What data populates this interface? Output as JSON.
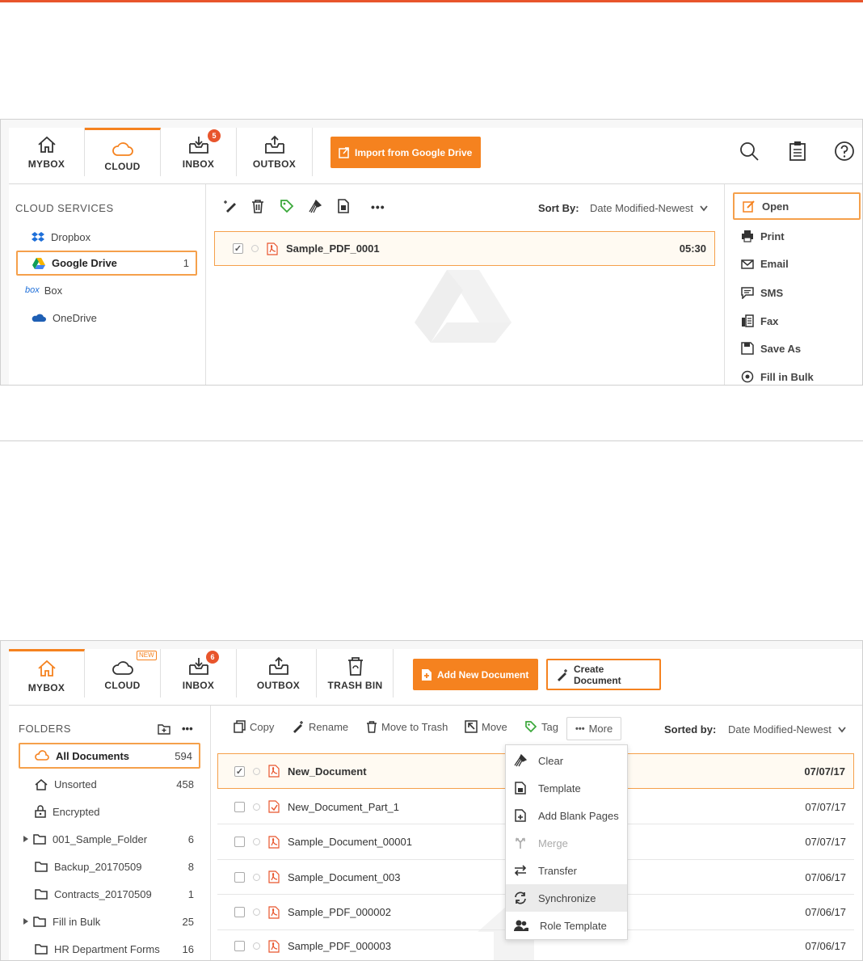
{
  "screen1": {
    "tabs": [
      {
        "label": "MYBOX"
      },
      {
        "label": "CLOUD"
      },
      {
        "label": "INBOX",
        "badge": "5"
      },
      {
        "label": "OUTBOX"
      }
    ],
    "import_button": "Import from Google Drive",
    "sidebar": {
      "heading": "CLOUD SERVICES",
      "items": [
        {
          "label": "Dropbox"
        },
        {
          "label": "Google Drive",
          "count": "1"
        },
        {
          "label": "Box"
        },
        {
          "label": "OneDrive"
        }
      ]
    },
    "sort_label": "Sort By:",
    "sort_value": "Date Modified-Newest",
    "file": {
      "name": "Sample_PDF_0001",
      "time": "05:30"
    },
    "actions": [
      {
        "label": "Open"
      },
      {
        "label": "Print"
      },
      {
        "label": "Email"
      },
      {
        "label": "SMS"
      },
      {
        "label": "Fax"
      },
      {
        "label": "Save As"
      },
      {
        "label": "Fill in Bulk"
      }
    ]
  },
  "screen2": {
    "tabs": [
      {
        "label": "MYBOX"
      },
      {
        "label": "CLOUD",
        "badge": "NEW"
      },
      {
        "label": "INBOX",
        "badge": "6"
      },
      {
        "label": "OUTBOX"
      },
      {
        "label": "TRASH BIN"
      }
    ],
    "add_button": "Add New Document",
    "create_button": "Create Document",
    "sidebar": {
      "heading": "FOLDERS",
      "items": [
        {
          "label": "All Documents",
          "count": "594"
        },
        {
          "label": "Unsorted",
          "count": "458"
        },
        {
          "label": "Encrypted",
          "count": ""
        },
        {
          "label": "001_Sample_Folder",
          "count": "6"
        },
        {
          "label": "Backup_20170509",
          "count": "8"
        },
        {
          "label": "Contracts_20170509",
          "count": "1"
        },
        {
          "label": "Fill in Bulk",
          "count": "25"
        },
        {
          "label": "HR Department Forms",
          "count": "16"
        }
      ]
    },
    "toolbar": {
      "copy": "Copy",
      "rename": "Rename",
      "trash": "Move to Trash",
      "move": "Move",
      "tag": "Tag",
      "more": "More"
    },
    "sort_label": "Sorted by:",
    "sort_value": "Date Modified-Newest",
    "files": [
      {
        "name": "New_Document",
        "date": "07/07/17"
      },
      {
        "name": "New_Document_Part_1",
        "date": "07/07/17"
      },
      {
        "name": "Sample_Document_00001",
        "date": "07/07/17"
      },
      {
        "name": "Sample_Document_003",
        "date": "07/06/17"
      },
      {
        "name": "Sample_PDF_000002",
        "date": "07/06/17"
      },
      {
        "name": "Sample_PDF_000003",
        "date": "07/06/17"
      }
    ],
    "more_menu": [
      {
        "label": "Clear"
      },
      {
        "label": "Template"
      },
      {
        "label": "Add Blank Pages"
      },
      {
        "label": "Merge"
      },
      {
        "label": "Transfer"
      },
      {
        "label": "Synchronize"
      },
      {
        "label": "Role Template"
      }
    ]
  }
}
